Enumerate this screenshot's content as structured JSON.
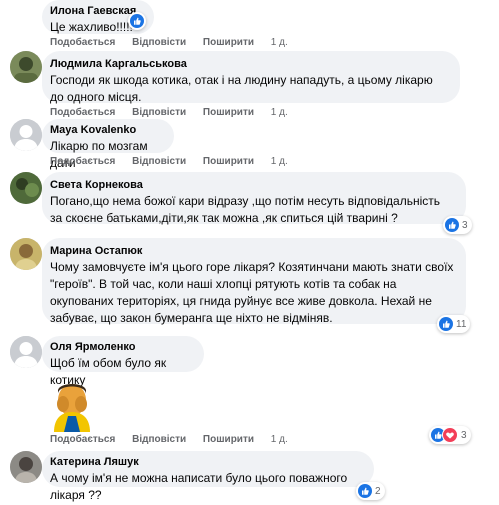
{
  "actions": {
    "like": "Подобається",
    "reply": "Відповісти",
    "share": "Поширити"
  },
  "comments": [
    {
      "author": "Илона Гаевская",
      "text": "Це жахливо!!!!!",
      "time": "1 д.",
      "reaction_count": ""
    },
    {
      "author": "Людмила Каргальськова",
      "text": "Господи як шкода котика, отак і на людину нападуть, а цьому лікарю до одного місця.",
      "time": "1 д.",
      "reaction_count": ""
    },
    {
      "author": "Maya Kovalenko",
      "text": "Лікарю по мозгам дати",
      "time": "1 д.",
      "reaction_count": ""
    },
    {
      "author": "Света Корнекова",
      "text": "Погано,що нема божої кари відразу ,що потім несуть відповідальність за скоєне батьками,діти,як так можна ,як спиться цій тварині ?",
      "time": "1 д.",
      "reaction_count": "3"
    },
    {
      "author": "Марина Остапюк",
      "text": "Чому замовчуєте ім'я цього горе лікаря? Козятинчани мають знати своїх \"героїв\". В той час, коли наші хлопці рятують котів та собак на окупованих територіях, ця гнида руйнує все живе довкола. Нехай не забуває, що закон бумеранга ще ніхто не відміняв.",
      "time": "1 д.",
      "reaction_count": "11"
    },
    {
      "author": "Оля Ярмоленко",
      "text": "Щоб їм обом було як котику",
      "time": "1 д.",
      "reaction_count": "3"
    },
    {
      "author": "Катерина Ляшук",
      "text": "А чому ім'я не можна написати було цього поважного лікаря ??",
      "time": "",
      "reaction_count": "2"
    }
  ],
  "icons": {
    "like": "thumbs-up-icon",
    "love": "heart-icon",
    "sticker": "crying-face-sticker"
  },
  "colors": {
    "like": "#1b74e4",
    "love": "#f33e58",
    "bubble": "#f0f2f5",
    "meta": "#65676b"
  }
}
